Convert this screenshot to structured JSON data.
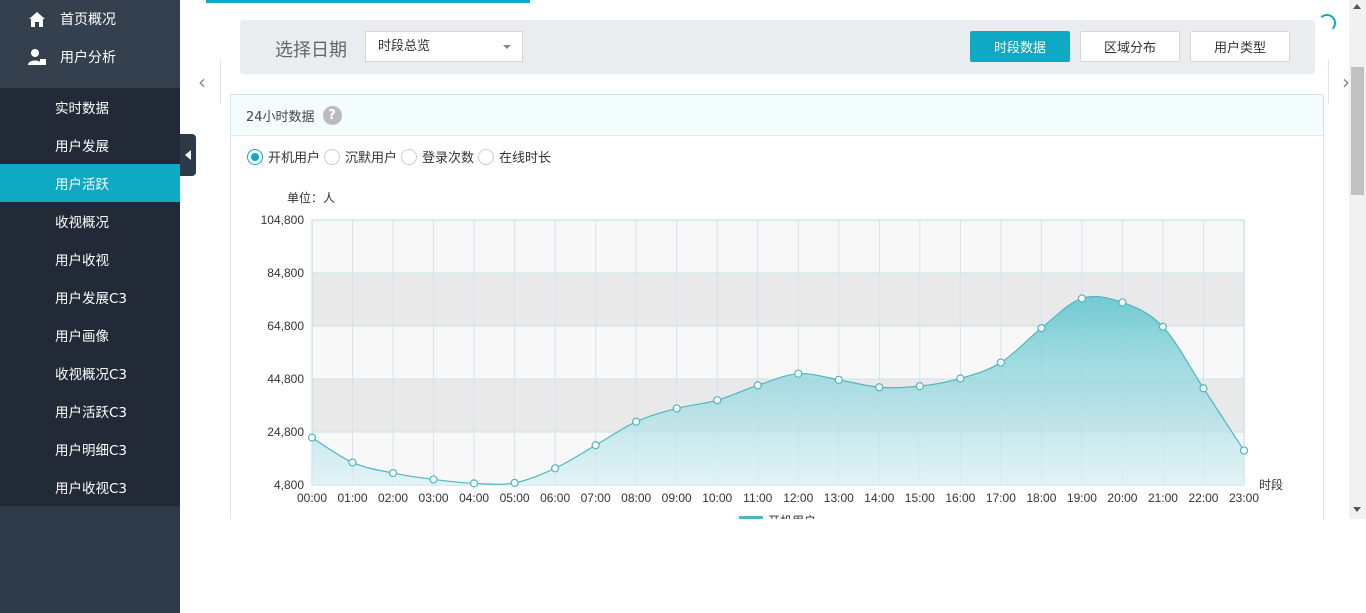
{
  "sidebar": {
    "top_items": [
      {
        "label": "首页概况",
        "icon": "home-icon"
      },
      {
        "label": "用户分析",
        "icon": "user-icon"
      }
    ],
    "sub_items": [
      {
        "label": "实时数据",
        "active": false
      },
      {
        "label": "用户发展",
        "active": false
      },
      {
        "label": "用户活跃",
        "active": true
      },
      {
        "label": "收视概况",
        "active": false
      },
      {
        "label": "用户收视",
        "active": false
      },
      {
        "label": "用户发展C3",
        "active": false
      },
      {
        "label": "用户画像",
        "active": false
      },
      {
        "label": "收视概况C3",
        "active": false
      },
      {
        "label": "用户活跃C3",
        "active": false
      },
      {
        "label": "用户明细C3",
        "active": false
      },
      {
        "label": "用户收视C3",
        "active": false
      }
    ]
  },
  "filter": {
    "label": "选择日期",
    "select_value": "时段总览",
    "tabs": [
      "时段数据",
      "区域分布",
      "用户类型"
    ],
    "active_tab": 0
  },
  "panel": {
    "title": "24小时数据",
    "help": "?",
    "radios": [
      "开机用户",
      "沉默用户",
      "登录次数",
      "在线时长"
    ],
    "selected_radio": 0
  },
  "colors": {
    "accent": "#0eaac3",
    "sidebar": "#2f3a48",
    "sidebar_sub": "#212a36"
  },
  "chart_data": {
    "type": "area",
    "unit_label": "单位：人",
    "xlabel": "时段",
    "ylim": [
      4800,
      104800
    ],
    "yticks": [
      "4,800",
      "24,800",
      "44,800",
      "64,800",
      "84,800",
      "104,800"
    ],
    "categories": [
      "00:00",
      "01:00",
      "02:00",
      "03:00",
      "04:00",
      "05:00",
      "06:00",
      "07:00",
      "08:00",
      "09:00",
      "10:00",
      "11:00",
      "12:00",
      "13:00",
      "14:00",
      "15:00",
      "16:00",
      "17:00",
      "18:00",
      "19:00",
      "20:00",
      "21:00",
      "22:00",
      "23:00"
    ],
    "series": [
      {
        "name": "开机用户",
        "values": [
          22700,
          13300,
          9300,
          6900,
          5400,
          5600,
          11100,
          19800,
          28700,
          33700,
          36800,
          42400,
          46800,
          44500,
          41700,
          42100,
          45000,
          51000,
          64000,
          75200,
          73700,
          64500,
          41300,
          17800
        ]
      }
    ],
    "legend": "bottom"
  }
}
